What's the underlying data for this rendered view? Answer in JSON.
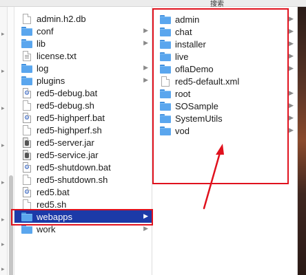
{
  "toolbar": {
    "search_label": "搜索"
  },
  "middle_column": {
    "items": [
      {
        "label": "admin.h2.db",
        "icon": "document-icon",
        "type": "doc",
        "has_arrow": false
      },
      {
        "label": "conf",
        "icon": "folder-icon",
        "type": "folder",
        "has_arrow": true
      },
      {
        "label": "lib",
        "icon": "folder-icon",
        "type": "folder",
        "has_arrow": true
      },
      {
        "label": "license.txt",
        "icon": "text-file-icon",
        "type": "txt",
        "has_arrow": false
      },
      {
        "label": "log",
        "icon": "folder-icon",
        "type": "folder",
        "has_arrow": true
      },
      {
        "label": "plugins",
        "icon": "folder-icon",
        "type": "folder",
        "has_arrow": true
      },
      {
        "label": "red5-debug.bat",
        "icon": "script-file-icon",
        "type": "bat",
        "has_arrow": false
      },
      {
        "label": "red5-debug.sh",
        "icon": "document-icon",
        "type": "doc",
        "has_arrow": false
      },
      {
        "label": "red5-highperf.bat",
        "icon": "script-file-icon",
        "type": "bat",
        "has_arrow": false
      },
      {
        "label": "red5-highperf.sh",
        "icon": "document-icon",
        "type": "doc",
        "has_arrow": false
      },
      {
        "label": "red5-server.jar",
        "icon": "jar-file-icon",
        "type": "jar",
        "has_arrow": false
      },
      {
        "label": "red5-service.jar",
        "icon": "jar-file-icon",
        "type": "jar",
        "has_arrow": false
      },
      {
        "label": "red5-shutdown.bat",
        "icon": "script-file-icon",
        "type": "bat",
        "has_arrow": false
      },
      {
        "label": "red5-shutdown.sh",
        "icon": "document-icon",
        "type": "doc",
        "has_arrow": false
      },
      {
        "label": "red5.bat",
        "icon": "script-file-icon",
        "type": "bat",
        "has_arrow": false
      },
      {
        "label": "red5.sh",
        "icon": "document-icon",
        "type": "doc",
        "has_arrow": false
      },
      {
        "label": "webapps",
        "icon": "folder-icon",
        "type": "folder",
        "has_arrow": true,
        "selected": true
      },
      {
        "label": "work",
        "icon": "folder-icon",
        "type": "folder",
        "has_arrow": true
      }
    ]
  },
  "right_column": {
    "items": [
      {
        "label": "admin",
        "icon": "folder-icon",
        "type": "folder",
        "has_arrow": true
      },
      {
        "label": "chat",
        "icon": "folder-icon",
        "type": "folder",
        "has_arrow": true
      },
      {
        "label": "installer",
        "icon": "folder-icon",
        "type": "folder",
        "has_arrow": true
      },
      {
        "label": "live",
        "icon": "folder-icon",
        "type": "folder",
        "has_arrow": true
      },
      {
        "label": "oflaDemo",
        "icon": "folder-icon",
        "type": "folder",
        "has_arrow": true
      },
      {
        "label": "red5-default.xml",
        "icon": "document-icon",
        "type": "doc",
        "has_arrow": false
      },
      {
        "label": "root",
        "icon": "folder-icon",
        "type": "folder",
        "has_arrow": true
      },
      {
        "label": "SOSample",
        "icon": "folder-icon",
        "type": "folder",
        "has_arrow": true
      },
      {
        "label": "SystemUtils",
        "icon": "folder-icon",
        "type": "folder",
        "has_arrow": true
      },
      {
        "label": "vod",
        "icon": "folder-icon",
        "type": "folder",
        "has_arrow": true
      }
    ]
  },
  "annotations": {
    "highlight_color": "#e0111d"
  },
  "colors": {
    "selection": "#1c3aa8",
    "folder": "#5aa6ee"
  }
}
